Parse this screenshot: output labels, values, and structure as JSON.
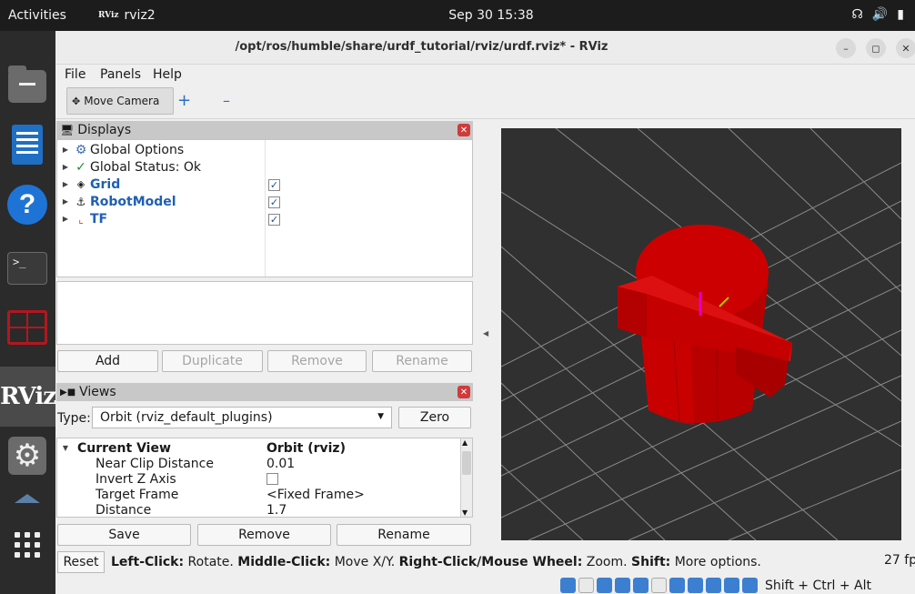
{
  "topbar": {
    "activities": "Activities",
    "app_name": "rviz2",
    "app_logo": "RViz",
    "clock": "Sep 30  15:38",
    "tray_icons": [
      "network-icon",
      "volume-icon",
      "battery-icon"
    ]
  },
  "dock": {
    "items": [
      "files",
      "writer",
      "help",
      "terminal",
      "terminator",
      "rviz",
      "settings",
      "mount",
      "show-apps"
    ],
    "rviz_label": "RViz"
  },
  "window": {
    "title": "/opt/ros/humble/share/urdf_tutorial/rviz/urdf.rviz* - RViz",
    "controls": {
      "minimize": "–",
      "maximize": "◻",
      "close": "✕"
    }
  },
  "menu": {
    "file": "File",
    "panels": "Panels",
    "help": "Help"
  },
  "toolbar": {
    "move_camera": "Move Camera",
    "add_tool": "+",
    "remove_tool": "–"
  },
  "displays": {
    "title": "Displays",
    "items": [
      {
        "label": "Global Options",
        "icon": "gear-icon",
        "checked": null
      },
      {
        "label": "Global Status: Ok",
        "icon": "check-icon",
        "checked": null
      },
      {
        "label": "Grid",
        "icon": "grid-icon",
        "checked": true
      },
      {
        "label": "RobotModel",
        "icon": "robot-icon",
        "checked": true
      },
      {
        "label": "TF",
        "icon": "axes-icon",
        "checked": true
      }
    ],
    "check_mark": "✓",
    "buttons": {
      "add": "Add",
      "duplicate": "Duplicate",
      "remove": "Remove",
      "rename": "Rename"
    }
  },
  "views": {
    "title": "Views",
    "type_label": "Type:",
    "type_value": "Orbit (rviz_default_plugins)",
    "zero": "Zero",
    "current_view": {
      "label": "Current View",
      "value": "Orbit (rviz)"
    },
    "properties": [
      {
        "label": "Near Clip Distance",
        "value": "0.01"
      },
      {
        "label": "Invert Z Axis",
        "value": ""
      },
      {
        "label": "Target Frame",
        "value": "<Fixed Frame>"
      },
      {
        "label": "Distance",
        "value": "1.7"
      }
    ],
    "buttons": {
      "save": "Save",
      "remove": "Remove",
      "rename": "Rename"
    }
  },
  "status": {
    "reset": "Reset",
    "left_click_key": "Left-Click:",
    "left_click_val": " Rotate. ",
    "middle_click_key": "Middle-Click:",
    "middle_click_val": " Move X/Y. ",
    "right_click_key": "Right-Click/Mouse Wheel:",
    "right_click_val": " Zoom. ",
    "shift_key": "Shift:",
    "shift_val": " More options.",
    "fps": "27 fp"
  },
  "keyboard": {
    "modifiers": "Shift + Ctrl + Alt"
  },
  "colors": {
    "robot_red": "#c40000",
    "viewport_bg": "#303030",
    "link_blue": "#1f5fb4"
  }
}
